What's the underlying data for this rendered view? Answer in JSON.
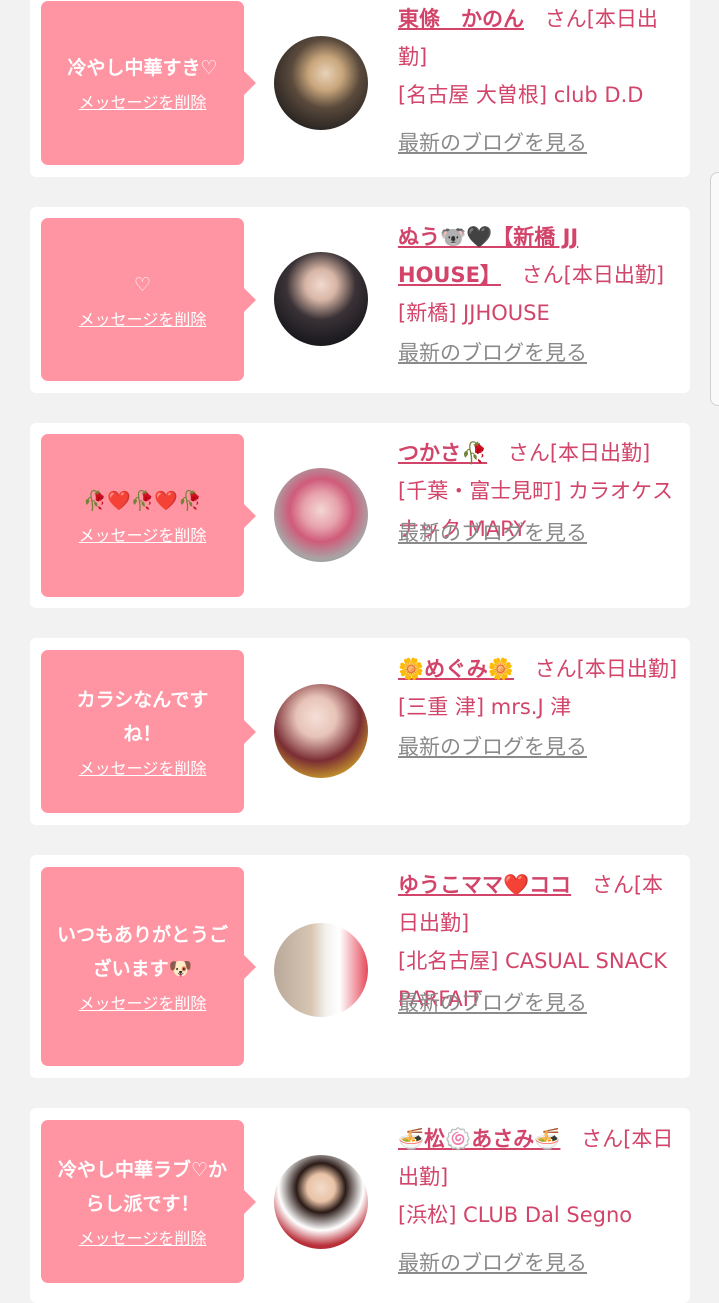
{
  "cards": [
    {
      "message": "冷やし中華すき♡",
      "delete_label": "メッセージを削除",
      "avatar_icon": "avatar-photo",
      "name": "東條　かのん",
      "honorific": "さん",
      "status": "[本日出勤]",
      "shop": "[名古屋 大曽根] club D.D",
      "blog_link": "最新のブログを見る"
    },
    {
      "message": "♡",
      "delete_label": "メッセージを削除",
      "avatar_icon": "avatar-photo",
      "name": "ぬう🐨🖤【新橋 JJ HOUSE】",
      "honorific": "さん",
      "status": "[本日出勤]",
      "shop": "[新橋] JJHOUSE",
      "blog_link": "最新のブログを見る"
    },
    {
      "message": "🥀❤️🥀❤️🥀",
      "delete_label": "メッセージを削除",
      "avatar_icon": "avatar-photo",
      "name": "つかさ🥀",
      "honorific": "さん",
      "status": "[本日出勤]",
      "shop": "[千葉・富士見町] カラオケスナック MARY",
      "blog_link": "最新のブログを見る"
    },
    {
      "message": "カラシなんですね！",
      "delete_label": "メッセージを削除",
      "avatar_icon": "avatar-photo",
      "name": "🌼めぐみ🌼",
      "honorific": "さん",
      "status": "[本日出勤]",
      "shop": "[三重 津] mrs.J 津",
      "blog_link": "最新のブログを見る"
    },
    {
      "message": "いつもありがとうございます🐶",
      "delete_label": "メッセージを削除",
      "avatar_icon": "avatar-photo",
      "name": "ゆうこママ❤️ココ",
      "honorific": "さん",
      "status": "[本日出勤]",
      "shop": "[北名古屋] CASUAL SNACK PARFAIT",
      "blog_link": "最新のブログを見る"
    },
    {
      "message": "冷やし中華ラブ♡からし派です！",
      "delete_label": "メッセージを削除",
      "avatar_icon": "avatar-photo",
      "name": "🍜松🍥あさみ🍜",
      "honorific": "さん",
      "status": "[本日出勤]",
      "shop": "[浜松] CLUB Dal Segno",
      "blog_link": "最新のブログを見る"
    }
  ],
  "colors": {
    "bubble": "#ff94a3",
    "accent_text": "#d2446a",
    "link_gray": "#8a8a8a",
    "page_bg": "#f2f2f2"
  }
}
